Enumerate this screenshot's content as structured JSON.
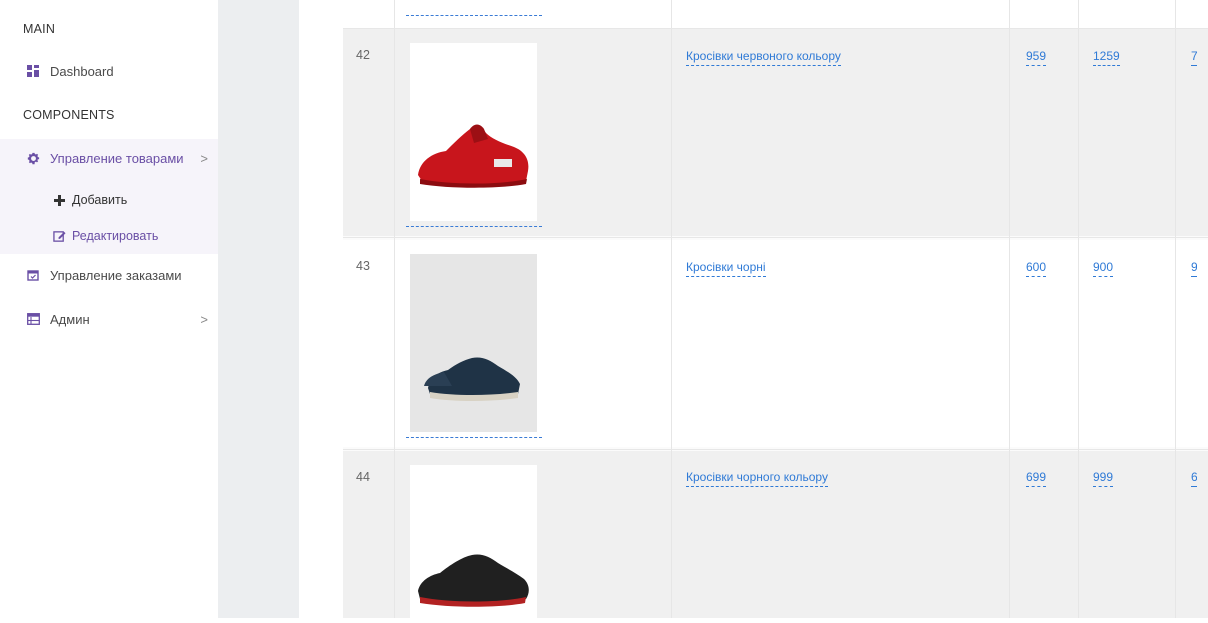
{
  "sidebar": {
    "main_title": "MAIN",
    "dashboard": "Dashboard",
    "components_title": "COMPONENTS",
    "products": "Управление товарами",
    "add": "Добавить",
    "edit": "Редактировать",
    "orders": "Управление заказами",
    "admin": "Админ",
    "chevron": ">"
  },
  "colors": {
    "accent": "#6a4fa5",
    "link": "#2f7ad6",
    "row_gray": "#f0f0f0"
  },
  "rows": [
    {
      "id": "42",
      "name": "Кросівки червоного кольору",
      "price": "959",
      "old_price": "1259",
      "extra": "7",
      "image": "red-sneaker"
    },
    {
      "id": "43",
      "name": "Кросівки чорні",
      "price": "600",
      "old_price": "900",
      "extra": "9",
      "image": "dark-blue-sneaker"
    },
    {
      "id": "44",
      "name": "Кросівки чорного кольору",
      "price": "699",
      "old_price": "999",
      "extra": "6",
      "image": "black-sneaker"
    }
  ]
}
